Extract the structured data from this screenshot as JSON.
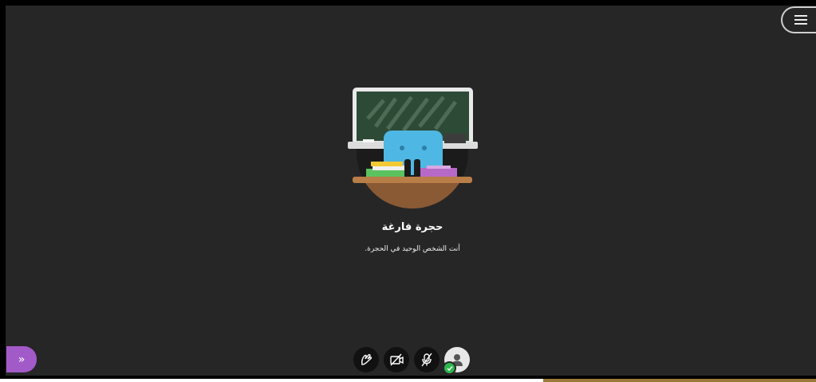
{
  "room": {
    "title": "حجرة فارغة",
    "description": "أنت الشخص الوحيد في الحجرة."
  },
  "panel_toggle": {
    "glyph": "»",
    "icon": "chevron-double-right-icon"
  },
  "menu": {
    "icon": "hamburger-menu-icon"
  },
  "controls": [
    {
      "name": "share-content-button",
      "icon": "raise-hand-icon"
    },
    {
      "name": "camera-toggle-button",
      "icon": "camera-off-icon"
    },
    {
      "name": "microphone-toggle-button",
      "icon": "microphone-off-icon"
    },
    {
      "name": "my-status-button",
      "icon": "avatar-icon"
    }
  ],
  "colors": {
    "stage_background": "#262626",
    "panel_toggle": "#a25ac8",
    "status_available": "#2db84d",
    "chalkboard": "#2d4a37",
    "chair": "#4fb7e3",
    "desk": "#b97d48"
  }
}
